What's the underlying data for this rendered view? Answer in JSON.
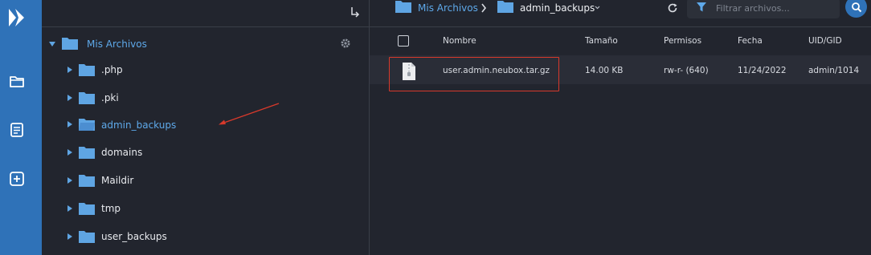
{
  "tree": {
    "root_label": "Mis Archivos",
    "items": [
      {
        "label": ".php"
      },
      {
        "label": ".pki"
      },
      {
        "label": "admin_backups"
      },
      {
        "label": "domains"
      },
      {
        "label": "Maildir"
      },
      {
        "label": "tmp"
      },
      {
        "label": "user_backups"
      }
    ]
  },
  "breadcrumb": {
    "root": "Mis Archivos",
    "current": "admin_backups"
  },
  "filter": {
    "placeholder": "Filtrar archivos..."
  },
  "table": {
    "headers": {
      "name": "Nombre",
      "size": "Tamaño",
      "perms": "Permisos",
      "date": "Fecha",
      "owner": "UID/GID"
    },
    "rows": [
      {
        "name": "user.admin.neubox.tar.gz",
        "size": "14.00 KB",
        "perms": "rw-r- (640)",
        "date": "11/24/2022",
        "owner": "admin/1014"
      }
    ]
  },
  "colors": {
    "accent": "#2f72b8",
    "folder": "#5fa5e3",
    "annotation": "#d7392b"
  }
}
